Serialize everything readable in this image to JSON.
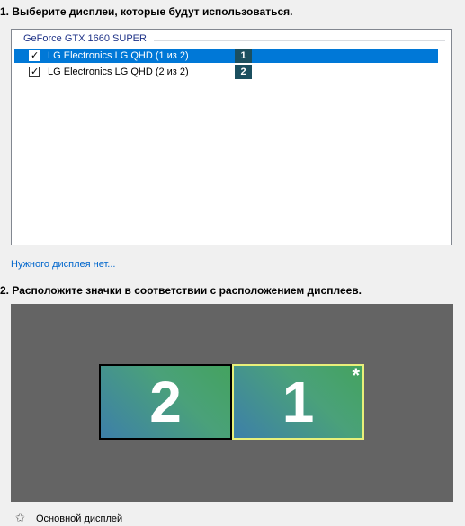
{
  "step1": {
    "heading": "1. Выберите дисплеи, которые будут использоваться."
  },
  "display_list": {
    "group_header": "GeForce GTX 1660 SUPER",
    "items": [
      {
        "label": "LG Electronics LG QHD (1 из 2)",
        "badge": "1",
        "checked": true,
        "selected": true
      },
      {
        "label": "LG Electronics LG QHD (2 из 2)",
        "badge": "2",
        "checked": true,
        "selected": false
      }
    ]
  },
  "missing_display_link": "Нужного дисплея нет...",
  "step2": {
    "heading": "2. Расположите значки в соответствии с расположением дисплеев."
  },
  "arrangement": {
    "monitors": [
      {
        "number": "2",
        "primary": false
      },
      {
        "number": "1",
        "primary": true,
        "marker": "*"
      }
    ]
  },
  "legend": {
    "primary_label": "Основной дисплей",
    "icon": "star-outline-icon"
  },
  "colors": {
    "selection": "#0078d7",
    "badge": "#1b4f5f",
    "arrange_bg": "#646464",
    "link": "#0066cc"
  }
}
